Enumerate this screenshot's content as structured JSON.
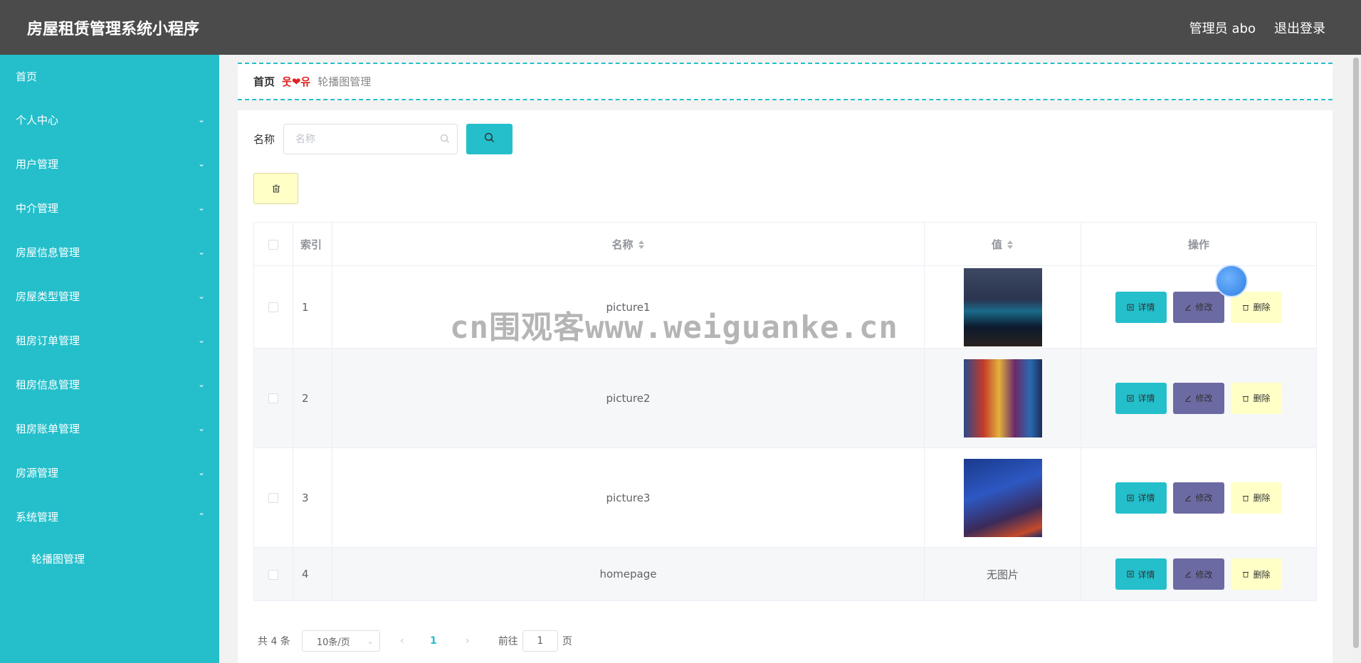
{
  "header": {
    "app_title": "房屋租赁管理系统小程序",
    "user_label": "管理员 abo",
    "logout_label": "退出登录"
  },
  "sidebar": {
    "home": "首页",
    "items": [
      {
        "label": "个人中心"
      },
      {
        "label": "用户管理"
      },
      {
        "label": "中介管理"
      },
      {
        "label": "房屋信息管理"
      },
      {
        "label": "房屋类型管理"
      },
      {
        "label": "租房订单管理"
      },
      {
        "label": "租房信息管理"
      },
      {
        "label": "租房账单管理"
      },
      {
        "label": "房源管理"
      },
      {
        "label": "系统管理"
      }
    ],
    "sub_item": "轮播图管理"
  },
  "breadcrumb": {
    "home": "首页",
    "separator": "웃❤유",
    "current": "轮播图管理"
  },
  "search": {
    "label": "名称",
    "placeholder": "名称",
    "value": ""
  },
  "table": {
    "headers": {
      "index": "索引",
      "name": "名称",
      "value": "值",
      "actions": "操作"
    },
    "rows": [
      {
        "index": "1",
        "name": "picture1",
        "value": ""
      },
      {
        "index": "2",
        "name": "picture2",
        "value": ""
      },
      {
        "index": "3",
        "name": "picture3",
        "value": ""
      },
      {
        "index": "4",
        "name": "homepage",
        "value": "无图片"
      }
    ],
    "actions": {
      "detail": "详情",
      "edit": "修改",
      "delete": "删除"
    }
  },
  "pagination": {
    "total": "共 4 条",
    "page_size": "10条/页",
    "current_page": "1",
    "goto_label": "前往",
    "goto_value": "1",
    "page_unit": "页"
  },
  "watermark": "cn围观客www.weiguanke.cn",
  "colors": {
    "accent": "#24bfcb",
    "header_bg": "#4b4b4b",
    "edit_button": "#6c6aa3",
    "delete_button": "#ffffc6"
  }
}
